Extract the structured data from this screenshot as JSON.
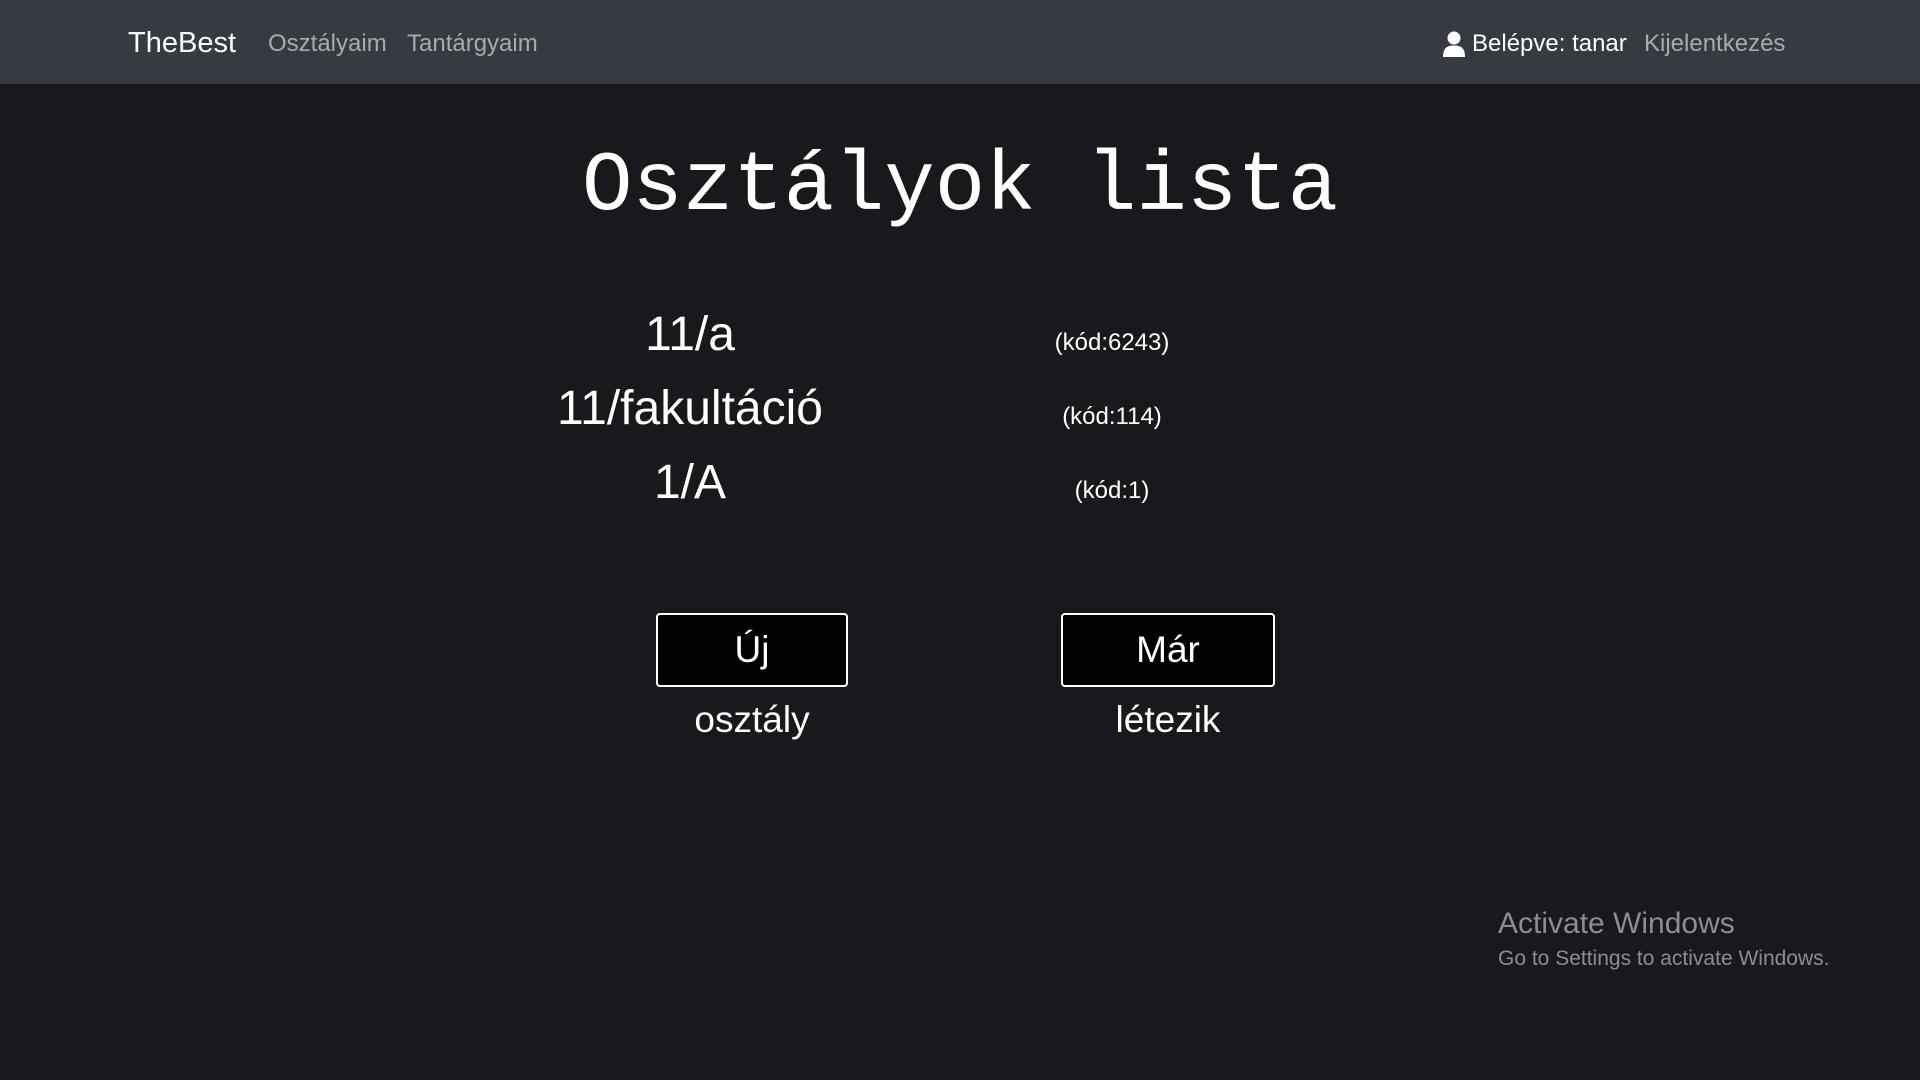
{
  "navbar": {
    "brand": "TheBest",
    "links": [
      {
        "label": "Osztályaim"
      },
      {
        "label": "Tantárgyaim"
      }
    ],
    "user_status": "Belépve: tanar",
    "logout": "Kijelentkezés",
    "user_icon": "user-icon"
  },
  "main": {
    "title": "Osztályok lista",
    "classes": [
      {
        "name": "11/a",
        "code": "(kód:6243)"
      },
      {
        "name": "11/fakultáció",
        "code": "(kód:114)"
      },
      {
        "name": "1/A",
        "code": "(kód:1)"
      }
    ],
    "buttons": {
      "new_class": "Új osztály",
      "existing": "Már létezik"
    }
  },
  "watermark": {
    "title": "Activate Windows",
    "subtitle": "Go to Settings to activate Windows."
  },
  "colors": {
    "background": "#18191c",
    "navbar": "#363a41",
    "nav_link": "#a7abb0",
    "text": "#ffffff",
    "button_bg": "#000000"
  }
}
